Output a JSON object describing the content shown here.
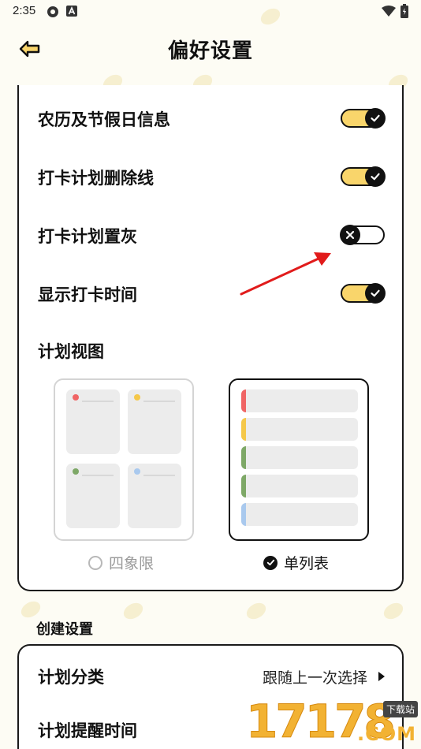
{
  "status_bar": {
    "time": "2:35"
  },
  "header": {
    "title": "偏好设置"
  },
  "settings": [
    {
      "label": "农历及节假日信息",
      "enabled": true
    },
    {
      "label": "打卡计划删除线",
      "enabled": true
    },
    {
      "label": "打卡计划置灰",
      "enabled": false
    },
    {
      "label": "显示打卡时间",
      "enabled": true
    }
  ],
  "plan_view": {
    "title": "计划视图",
    "options": [
      {
        "label": "四象限",
        "selected": false,
        "colors": [
          "#f06565",
          "#f5c84a",
          "#7ea867",
          "#a9c9ee"
        ]
      },
      {
        "label": "单列表",
        "selected": true,
        "colors": [
          "#f06565",
          "#f5c84a",
          "#7ea867",
          "#7ea867",
          "#a9c9ee"
        ]
      }
    ]
  },
  "create_settings": {
    "title": "创建设置",
    "plan_category": {
      "label": "计划分类",
      "value": "跟随上一次选择"
    },
    "next_label": "计划提醒时间"
  },
  "colors": {
    "toggle_on": "#f9d56b",
    "annotation_arrow": "#e11b1b",
    "accent": "#f2b233"
  },
  "watermark": {
    "number": "17178",
    "tag": "下载站",
    "suffix": ".COM"
  }
}
